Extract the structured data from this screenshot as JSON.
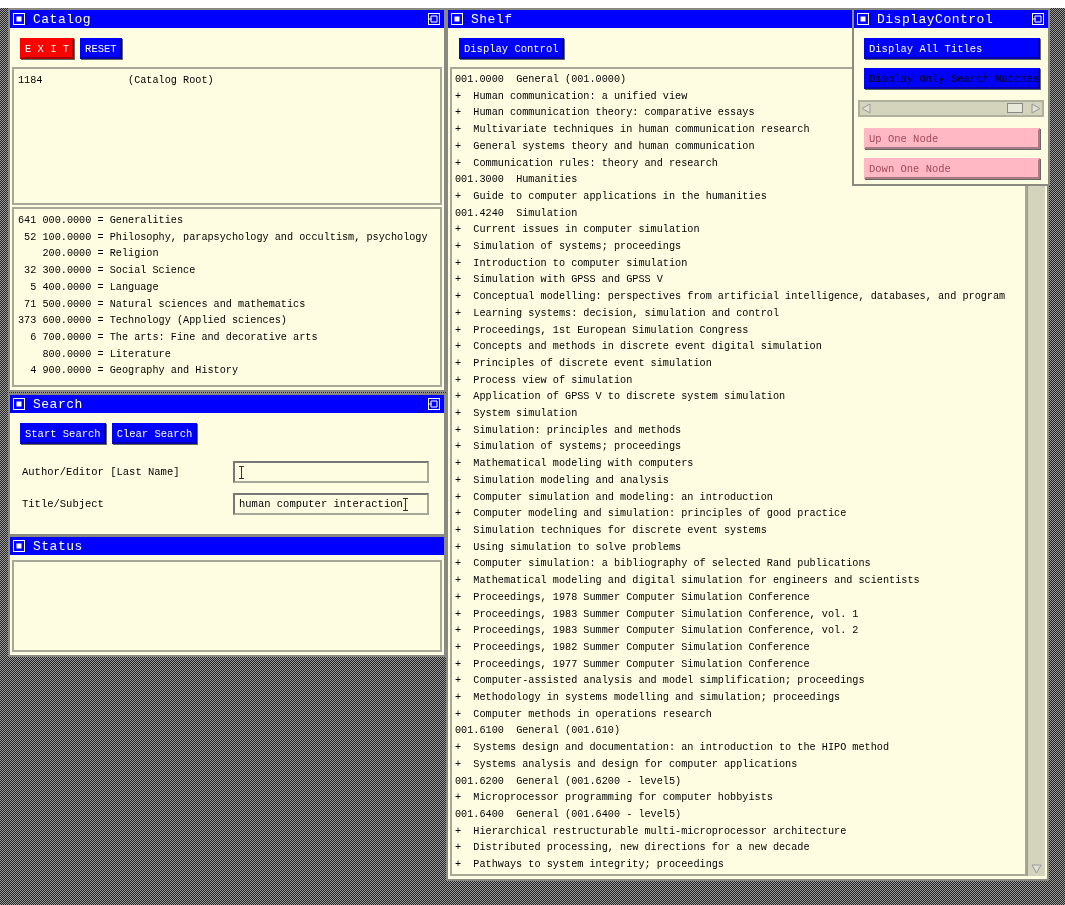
{
  "catalog": {
    "title": "Catalog",
    "maximize_button": true,
    "buttons": [
      {
        "label": "E X I T",
        "kind": "exit"
      },
      {
        "label": "RESET",
        "kind": "normal"
      }
    ],
    "root": {
      "count": "1184",
      "label": "(Catalog Root)"
    },
    "categories": [
      {
        "count": "641",
        "text": "000.0000 = Generalities"
      },
      {
        "count": "52",
        "text": "100.0000 = Philosophy, parapsychology and occultism, psychology"
      },
      {
        "text": "200.0000 = Religion"
      },
      {
        "count": "32",
        "text": "300.0000 = Social Science"
      },
      {
        "count": "5",
        "text": "400.0000 = Language"
      },
      {
        "count": "71",
        "text": "500.0000 = Natural sciences and mathematics"
      },
      {
        "count": "373",
        "text": "600.0000 = Technology (Applied sciences)"
      },
      {
        "count": "6",
        "text": "700.0000 = The arts: Fine and decorative arts"
      },
      {
        "text": "800.0000 = Literature"
      },
      {
        "count": "4",
        "text": "900.0000 = Geography and History"
      }
    ]
  },
  "search": {
    "title": "Search",
    "maximize_button": true,
    "buttons": [
      "Start Search",
      "Clear Search"
    ],
    "fields": [
      {
        "label": "Author/Editor [Last Name]"
      },
      {
        "label": "Title/Subject",
        "value": "human computer interaction"
      }
    ]
  },
  "status": {
    "title": "Status",
    "maximize_button": false
  },
  "shelf": {
    "title": "Shelf",
    "buttons": [
      "Display Control"
    ],
    "lines": [
      {
        "kind": "class",
        "code": "001.0000",
        "title": "General (001.0000)"
      },
      {
        "kind": "book",
        "marker": "+",
        "title": "Human communication: a unified view"
      },
      {
        "kind": "book",
        "marker": "+",
        "title": "Human communication theory: comparative essays"
      },
      {
        "kind": "book",
        "marker": "+",
        "title": "Multivariate techniques in human communication research"
      },
      {
        "kind": "book",
        "marker": "+",
        "title": "General systems theory and human communication"
      },
      {
        "kind": "book",
        "marker": "+",
        "title": "Communication rules: theory and research"
      },
      {
        "kind": "class",
        "code": "001.3000",
        "title": "Humanities"
      },
      {
        "kind": "book",
        "marker": "+",
        "title": "Guide to computer applications in the humanities"
      },
      {
        "kind": "class",
        "code": "001.4240",
        "title": "Simulation"
      },
      {
        "kind": "book",
        "marker": "+",
        "title": "Current issues in computer simulation"
      },
      {
        "kind": "book",
        "marker": "+",
        "title": "Simulation of systems; proceedings"
      },
      {
        "kind": "book",
        "marker": "+",
        "title": "Introduction to computer simulation"
      },
      {
        "kind": "book",
        "marker": "+",
        "title": "Simulation with GPSS and GPSS V"
      },
      {
        "kind": "book",
        "marker": "+",
        "title": "Conceptual modelling: perspectives from artificial intelligence, databases, and program"
      },
      {
        "kind": "book",
        "marker": "+",
        "title": "Learning systems: decision, simulation and control"
      },
      {
        "kind": "book",
        "marker": "+",
        "title": "Proceedings, 1st European Simulation Congress"
      },
      {
        "kind": "book",
        "marker": "+",
        "title": "Concepts and methods in discrete event digital simulation"
      },
      {
        "kind": "book",
        "marker": "+",
        "title": "Principles of discrete event simulation"
      },
      {
        "kind": "book",
        "marker": "+",
        "title": "Process view of simulation"
      },
      {
        "kind": "book",
        "marker": "+",
        "title": "Application of GPSS V to discrete system simulation"
      },
      {
        "kind": "book",
        "marker": "+",
        "title": "System simulation"
      },
      {
        "kind": "book",
        "marker": "+",
        "title": "Simulation: principles and methods"
      },
      {
        "kind": "book",
        "marker": "+",
        "title": "Simulation of systems; proceedings"
      },
      {
        "kind": "book",
        "marker": "+",
        "title": "Mathematical modeling with computers"
      },
      {
        "kind": "book",
        "marker": "+",
        "title": "Simulation modeling and analysis"
      },
      {
        "kind": "book",
        "marker": "+",
        "title": "Computer simulation and modeling: an introduction"
      },
      {
        "kind": "book",
        "marker": "+",
        "title": "Computer modeling and simulation: principles of good practice"
      },
      {
        "kind": "book",
        "marker": "+",
        "title": "Simulation techniques for discrete event systems"
      },
      {
        "kind": "book",
        "marker": "+",
        "title": "Using simulation to solve problems"
      },
      {
        "kind": "book",
        "marker": "+",
        "title": "Computer simulation: a bibliography of selected Rand publications"
      },
      {
        "kind": "book",
        "marker": "+",
        "title": "Mathematical modeling and digital simulation for engineers and scientists"
      },
      {
        "kind": "book",
        "marker": "+",
        "title": "Proceedings, 1978 Summer Computer Simulation Conference"
      },
      {
        "kind": "book",
        "marker": "+",
        "title": "Proceedings, 1983 Summer Computer Simulation Conference, vol. 1"
      },
      {
        "kind": "book",
        "marker": "+",
        "title": "Proceedings, 1983 Summer Computer Simulation Conference, vol. 2"
      },
      {
        "kind": "book",
        "marker": "+",
        "title": "Proceedings, 1982 Summer Computer Simulation Conference"
      },
      {
        "kind": "book",
        "marker": "+",
        "title": "Proceedings, 1977 Summer Computer Simulation Conference"
      },
      {
        "kind": "book",
        "marker": "+",
        "title": "Computer-assisted analysis and model simplification; proceedings"
      },
      {
        "kind": "book",
        "marker": "+",
        "title": "Methodology in systems modelling and simulation; proceedings"
      },
      {
        "kind": "book",
        "marker": "+",
        "title": "Computer methods in operations research"
      },
      {
        "kind": "class",
        "code": "001.6100",
        "title": "General (001.610)"
      },
      {
        "kind": "book",
        "marker": "+",
        "title": "Systems design and documentation: an introduction to the HIPO method"
      },
      {
        "kind": "book",
        "marker": "+",
        "title": "Systems analysis and design for computer applications"
      },
      {
        "kind": "class",
        "code": "001.6200",
        "title": "General (001.6200 - level5)"
      },
      {
        "kind": "book",
        "marker": "+",
        "title": "Microprocessor programming for computer hobbyists"
      },
      {
        "kind": "class",
        "code": "001.6400",
        "title": "General (001.6400 - level5)"
      },
      {
        "kind": "book",
        "marker": "+",
        "title": "Hierarchical restructurable multi-microprocessor architecture"
      },
      {
        "kind": "book",
        "marker": "+",
        "title": "Distributed processing, new directions for a new decade"
      },
      {
        "kind": "book",
        "marker": "+",
        "title": "Pathways to system integrity; proceedings"
      }
    ]
  },
  "display_control": {
    "title": "DisplayControl",
    "maximize_button": true,
    "buttons": [
      {
        "label": "Display All Titles",
        "selected": false
      },
      {
        "label": "Display Only Search Matches",
        "selected": true
      }
    ],
    "slider": {
      "level": 0.95
    },
    "nav_buttons": [
      {
        "label": "Up One Node",
        "disabled": true
      },
      {
        "label": "Down One Node",
        "disabled": true
      }
    ]
  }
}
